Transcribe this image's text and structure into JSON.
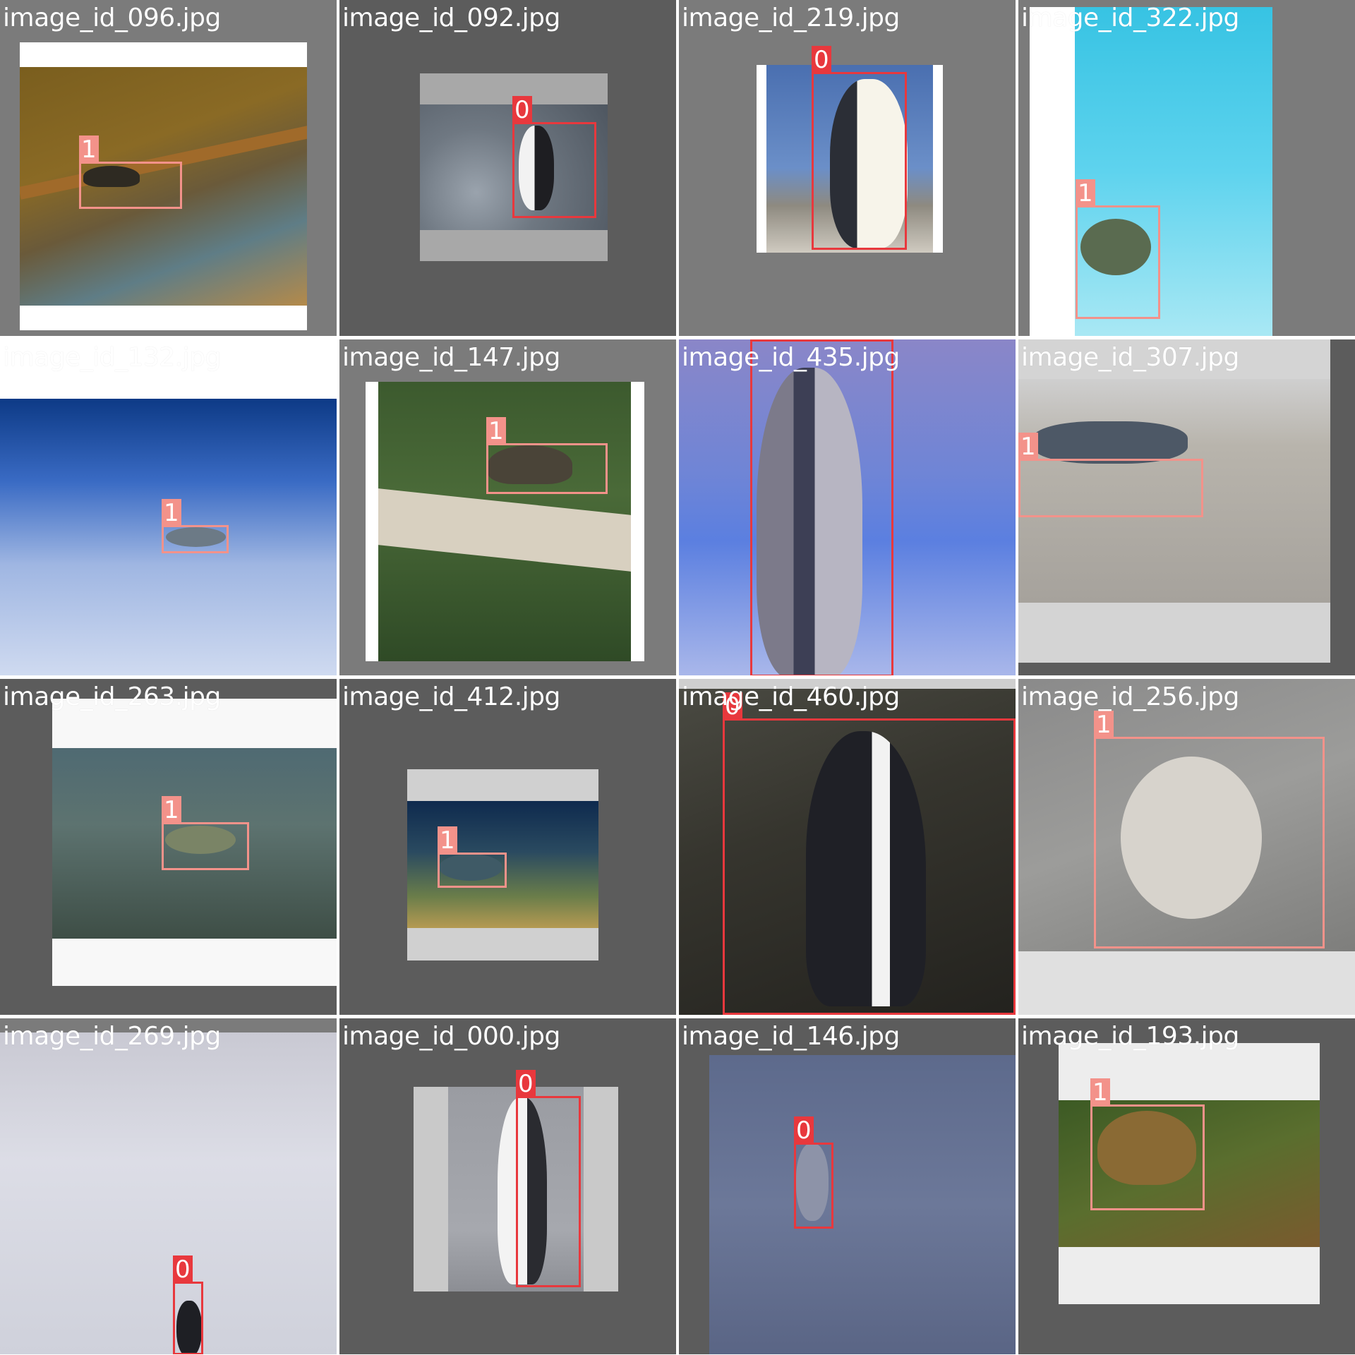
{
  "grid": {
    "tiles": [
      {
        "caption": "image_id_096.jpg",
        "detections": [
          {
            "class_label": "1",
            "object": "turtle"
          }
        ]
      },
      {
        "caption": "image_id_092.jpg",
        "detections": [
          {
            "class_label": "0",
            "object": "penguin"
          }
        ]
      },
      {
        "caption": "image_id_219.jpg",
        "detections": [
          {
            "class_label": "0",
            "object": "penguin"
          }
        ]
      },
      {
        "caption": "image_id_322.jpg",
        "detections": [
          {
            "class_label": "1",
            "object": "turtle"
          }
        ]
      },
      {
        "caption": "image_id_132.jpg",
        "detections": [
          {
            "class_label": "1",
            "object": "turtle"
          }
        ]
      },
      {
        "caption": "image_id_147.jpg",
        "detections": [
          {
            "class_label": "1",
            "object": "turtle"
          }
        ]
      },
      {
        "caption": "image_id_435.jpg",
        "detections": [
          {
            "class_label": "0",
            "object": "penguin"
          }
        ]
      },
      {
        "caption": "image_id_307.jpg",
        "detections": [
          {
            "class_label": "1",
            "object": "turtle"
          }
        ]
      },
      {
        "caption": "image_id_263.jpg",
        "detections": [
          {
            "class_label": "1",
            "object": "turtle"
          }
        ]
      },
      {
        "caption": "image_id_412.jpg",
        "detections": [
          {
            "class_label": "1",
            "object": "turtle"
          }
        ]
      },
      {
        "caption": "image_id_460.jpg",
        "detections": [
          {
            "class_label": "0",
            "object": "penguin"
          }
        ]
      },
      {
        "caption": "image_id_256.jpg",
        "detections": [
          {
            "class_label": "1",
            "object": "turtle"
          }
        ]
      },
      {
        "caption": "image_id_269.jpg",
        "detections": [
          {
            "class_label": "0",
            "object": "penguin"
          }
        ]
      },
      {
        "caption": "image_id_000.jpg",
        "detections": [
          {
            "class_label": "0",
            "object": "penguin"
          }
        ]
      },
      {
        "caption": "image_id_146.jpg",
        "detections": [
          {
            "class_label": "0",
            "object": "penguin"
          }
        ]
      },
      {
        "caption": "image_id_193.jpg",
        "detections": [
          {
            "class_label": "1",
            "object": "turtle"
          }
        ]
      }
    ]
  },
  "colors": {
    "class_0_box": "#e8383d",
    "class_1_box": "#f3928a",
    "caption_text": "#ffffff"
  }
}
